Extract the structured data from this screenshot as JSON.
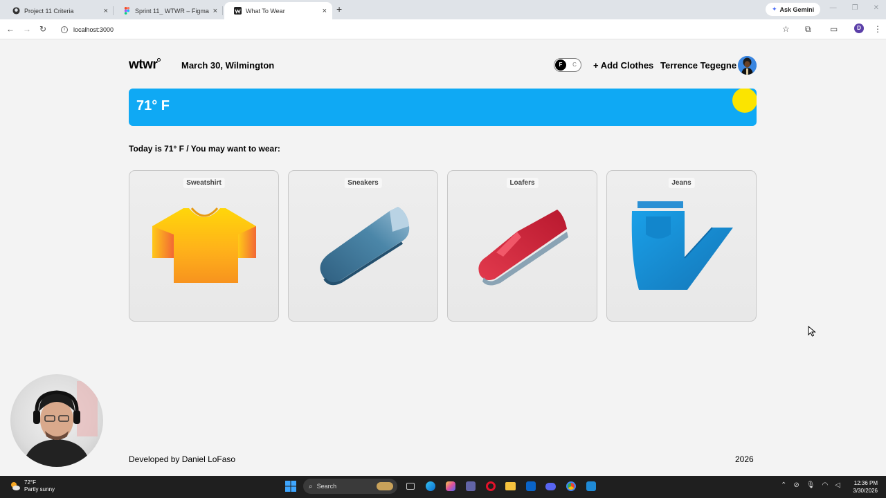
{
  "browser": {
    "tabs": [
      {
        "label": "Project 11 Criteria",
        "favicon": "github-icon"
      },
      {
        "label": "Sprint 11_ WTWR – Figma",
        "favicon": "figma-icon"
      },
      {
        "label": "What To Wear",
        "favicon": "wtwr-icon",
        "active": true
      }
    ],
    "new_tab": "+",
    "gemini_label": "Ask Gemini",
    "url": "localhost:3000",
    "profile_initial": "D"
  },
  "header": {
    "logo": "wtwr",
    "date_location": "March 30, Wilmington",
    "toggle": {
      "f_label": "F",
      "c_label": "C",
      "selected": "F"
    },
    "add_clothes_label": "+ Add Clothes",
    "username": "Terrence Tegegne"
  },
  "weather": {
    "temperature": "71° F",
    "banner_color": "#0fa9f4",
    "sun_color": "#fbe400"
  },
  "main": {
    "wear_text": "Today is 71° F / You may want to wear:",
    "cards": [
      {
        "name": "Sweatshirt",
        "icon": "sweatshirt-icon"
      },
      {
        "name": "Sneakers",
        "icon": "sneaker-icon"
      },
      {
        "name": "Loafers",
        "icon": "loafer-icon"
      },
      {
        "name": "Jeans",
        "icon": "jeans-icon"
      }
    ]
  },
  "footer": {
    "developer": "Developed by Daniel LoFaso",
    "year": "2026"
  },
  "taskbar": {
    "weather_temp": "72°F",
    "weather_desc": "Partly sunny",
    "search_label": "Search",
    "time": "12:36 PM",
    "date": "3/30/2026"
  }
}
